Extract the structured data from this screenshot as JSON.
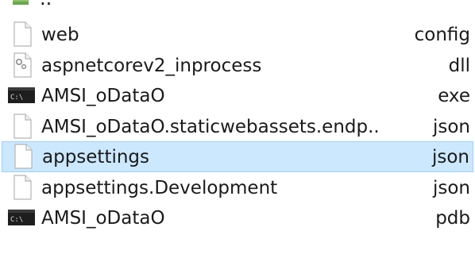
{
  "parent": {
    "label": "..",
    "icon": "folder-up-icon"
  },
  "files": [
    {
      "name": "web",
      "ext": "config",
      "icon": "document-icon",
      "selected": false
    },
    {
      "name": "aspnetcorev2_inprocess",
      "ext": "dll",
      "icon": "dll-gear-icon",
      "selected": false
    },
    {
      "name": "AMSI_oDataO",
      "ext": "exe",
      "icon": "console-app-icon",
      "selected": false
    },
    {
      "name": "AMSI_oDataO.staticwebassets.endp..",
      "ext": "json",
      "icon": "document-icon",
      "selected": false
    },
    {
      "name": "appsettings",
      "ext": "json",
      "icon": "document-icon",
      "selected": true
    },
    {
      "name": "appsettings.Development",
      "ext": "json",
      "icon": "document-icon",
      "selected": false
    },
    {
      "name": "AMSI_oDataO",
      "ext": "pdb",
      "icon": "console-app-icon",
      "selected": false
    }
  ],
  "colors": {
    "selection_bg": "#cce8ff",
    "selection_border": "#99d1ff"
  }
}
